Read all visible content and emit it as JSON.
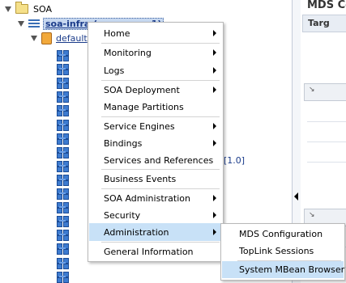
{
  "tree": {
    "root_label": "SOA",
    "infra_label": "soa-infra (soa_server1)",
    "default_label": "default",
    "component_rows": 17,
    "version_text": "[1.0]"
  },
  "right_panel": {
    "title": "MDS Co",
    "tab_label": "Targ"
  },
  "menu": {
    "items": [
      {
        "label": "Home",
        "submenu": true
      },
      {
        "label": "Monitoring",
        "submenu": true
      },
      {
        "label": "Logs",
        "submenu": true
      },
      {
        "label": "SOA Deployment",
        "submenu": true
      },
      {
        "label": "Manage Partitions",
        "submenu": false
      },
      {
        "label": "Service Engines",
        "submenu": true
      },
      {
        "label": "Bindings",
        "submenu": true
      },
      {
        "label": "Services and References",
        "submenu": false
      },
      {
        "label": "Business Events",
        "submenu": false
      },
      {
        "label": "SOA Administration",
        "submenu": true
      },
      {
        "label": "Security",
        "submenu": true
      },
      {
        "label": "Administration",
        "submenu": true,
        "highlighted": true
      },
      {
        "label": "General Information",
        "submenu": false
      }
    ]
  },
  "submenu": {
    "items": [
      {
        "label": "MDS Configuration"
      },
      {
        "label": "TopLink Sessions"
      },
      {
        "label": "System MBean Browser",
        "highlighted": true
      }
    ]
  },
  "colors": {
    "highlight": "#c8e1f7",
    "link": "#1a3b8a"
  }
}
